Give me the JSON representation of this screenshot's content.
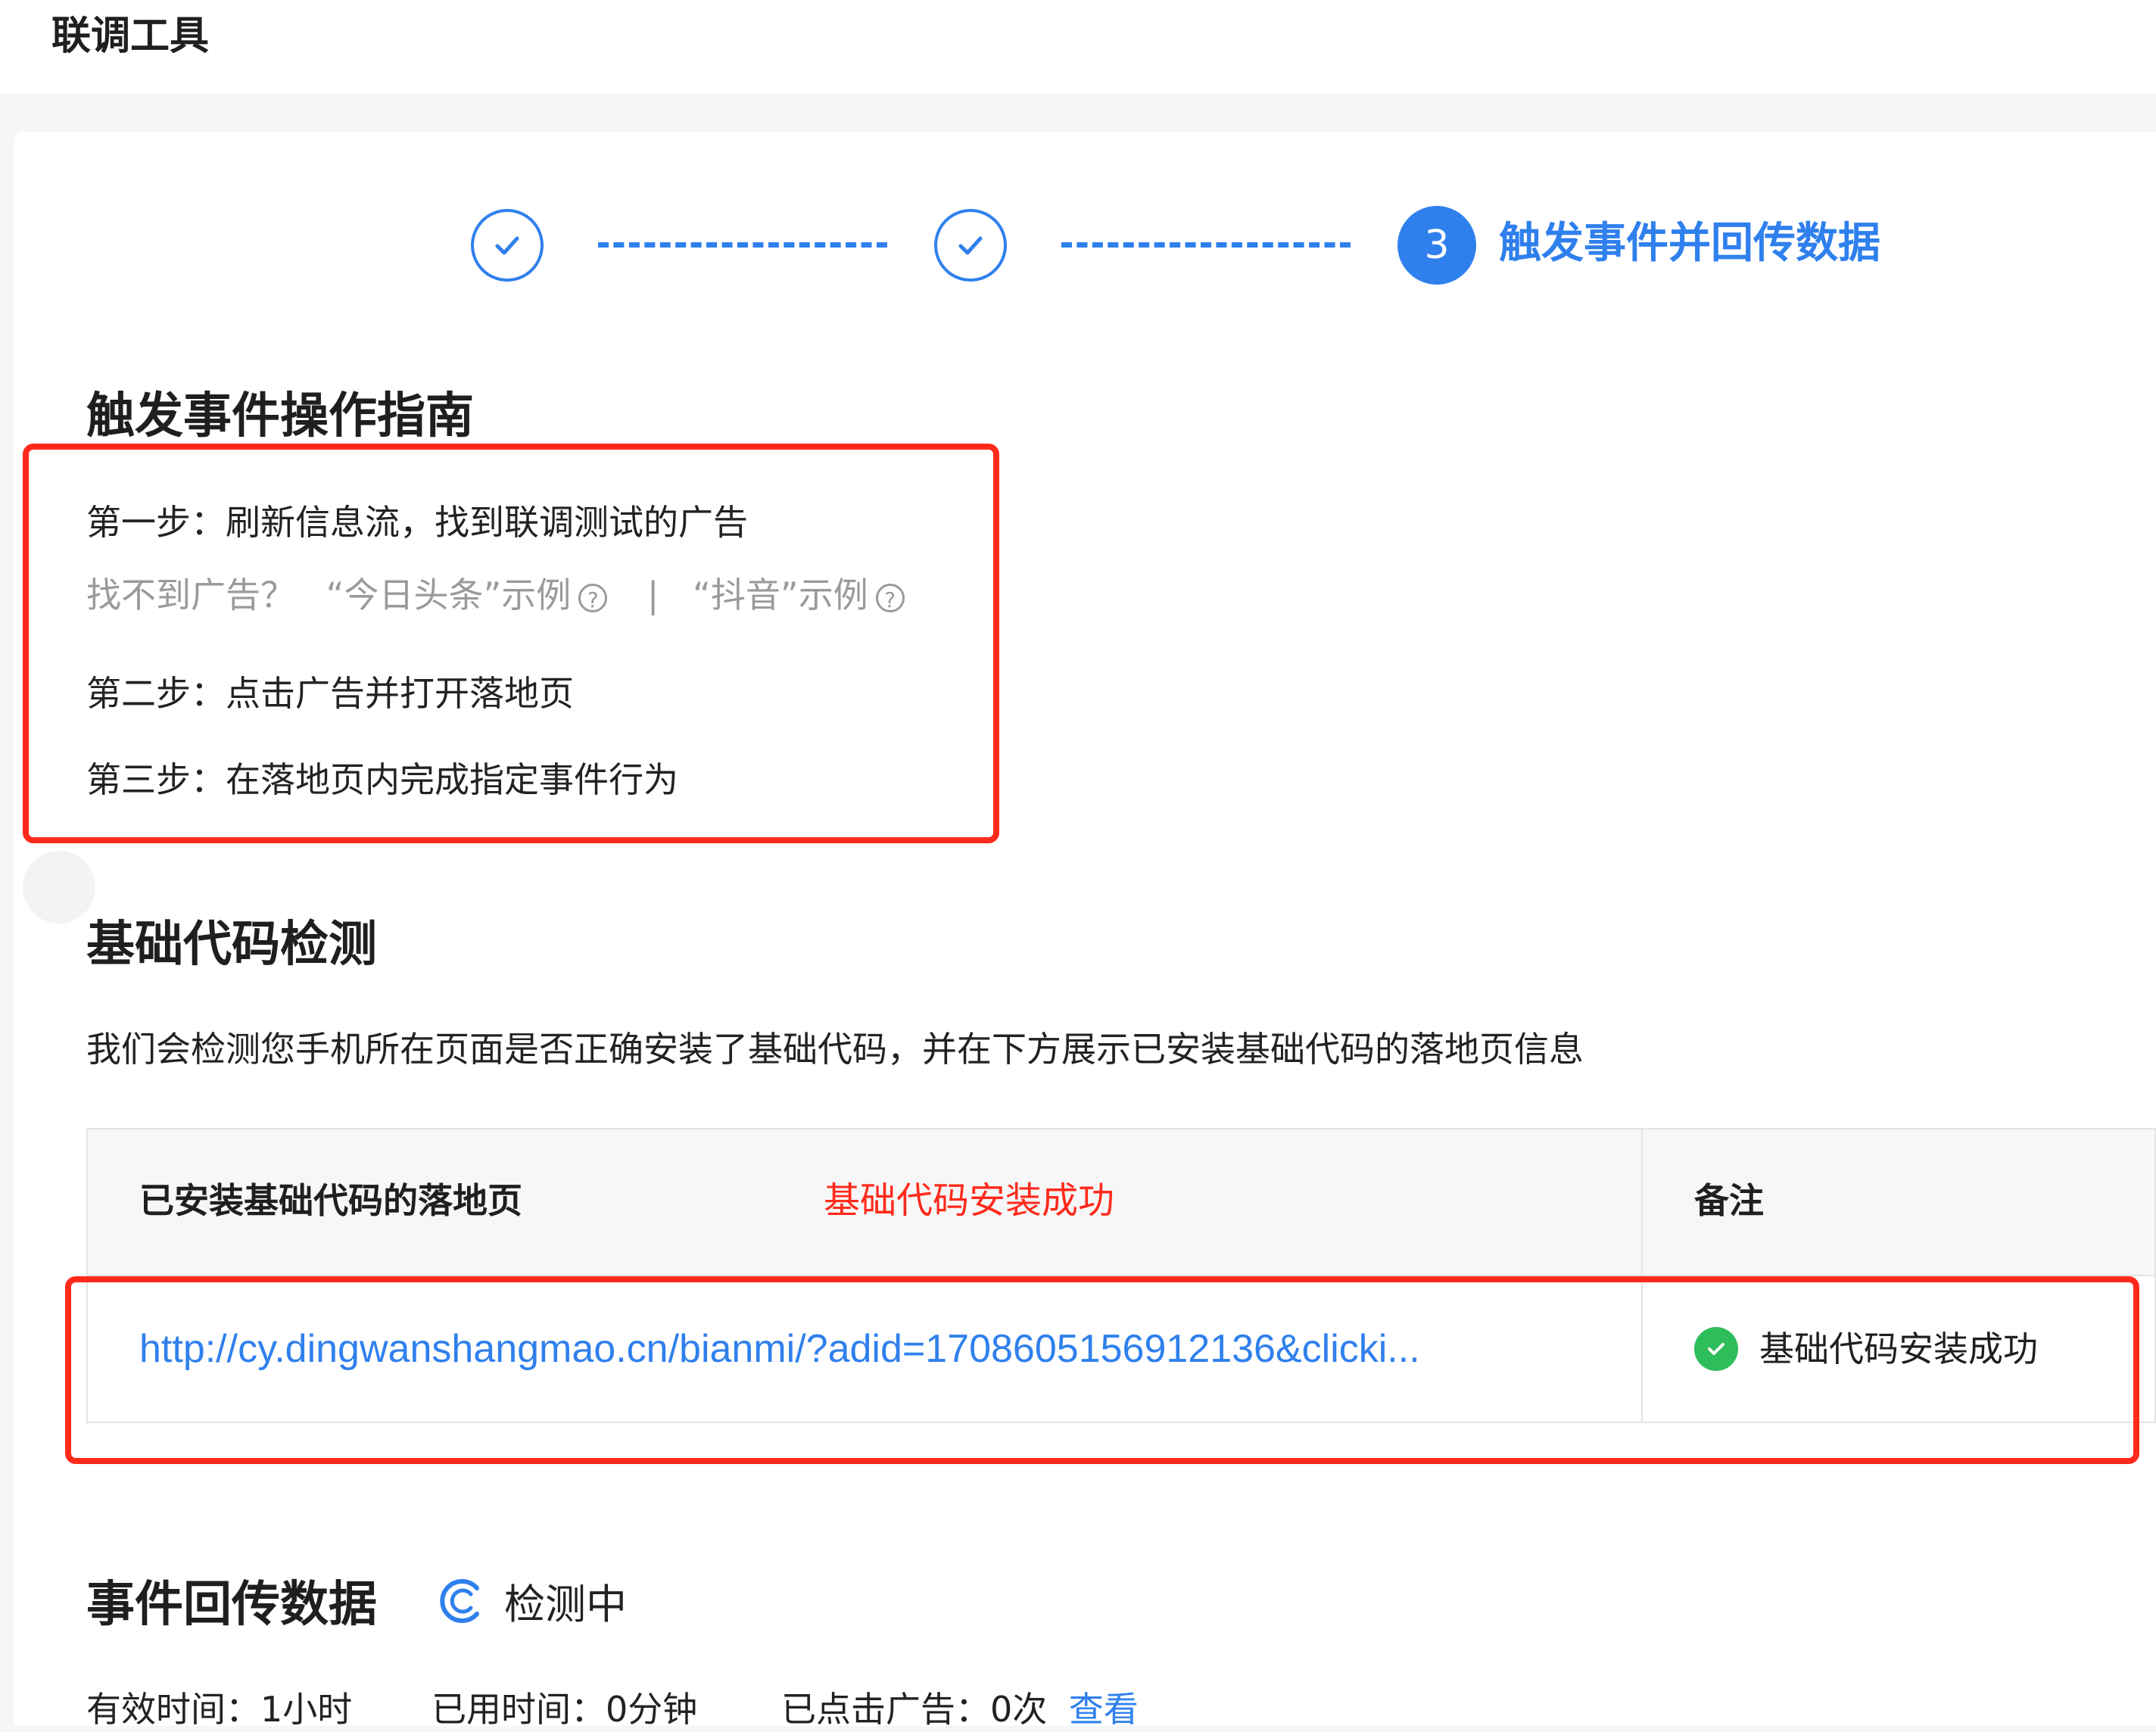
{
  "app": {
    "title": "联调工具"
  },
  "steps": {
    "active_number": "3",
    "active_label": "触发事件并回传数据"
  },
  "guide": {
    "heading": "触发事件操作指南",
    "step1": "第一步：刷新信息流，找到联调测试的广告",
    "help_prefix": "找不到广告？",
    "example_toutiao": "“今日头条”示例",
    "separator": "|",
    "example_douyin": "“抖音”示例",
    "step2": "第二步：点击广告并打开落地页",
    "step3": "第三步：在落地页内完成指定事件行为"
  },
  "code_check": {
    "heading": "基础代码检测",
    "description": "我们会检测您手机所在页面是否正确安装了基础代码，并在下方展示已安装基础代码的落地页信息",
    "table": {
      "col_landing": "已安装基础代码的落地页",
      "annotation": "基础代码安装成功",
      "col_note": "备注",
      "row_url": "http://cy.dingwanshangmao.cn/bianmi/?adid=1708605156912136&clicki...",
      "row_status": "基础代码安装成功"
    }
  },
  "events": {
    "heading": "事件回传数据",
    "status": "检测中",
    "valid_time": "有效时间：1小时",
    "used_time": "已用时间：0分钟",
    "clicked_ads": "已点击广告：0次",
    "view_link": "查看"
  },
  "colors": {
    "accent": "#2f80ed",
    "annotation_red": "#ff2a1b",
    "success": "#2dbd5a"
  }
}
